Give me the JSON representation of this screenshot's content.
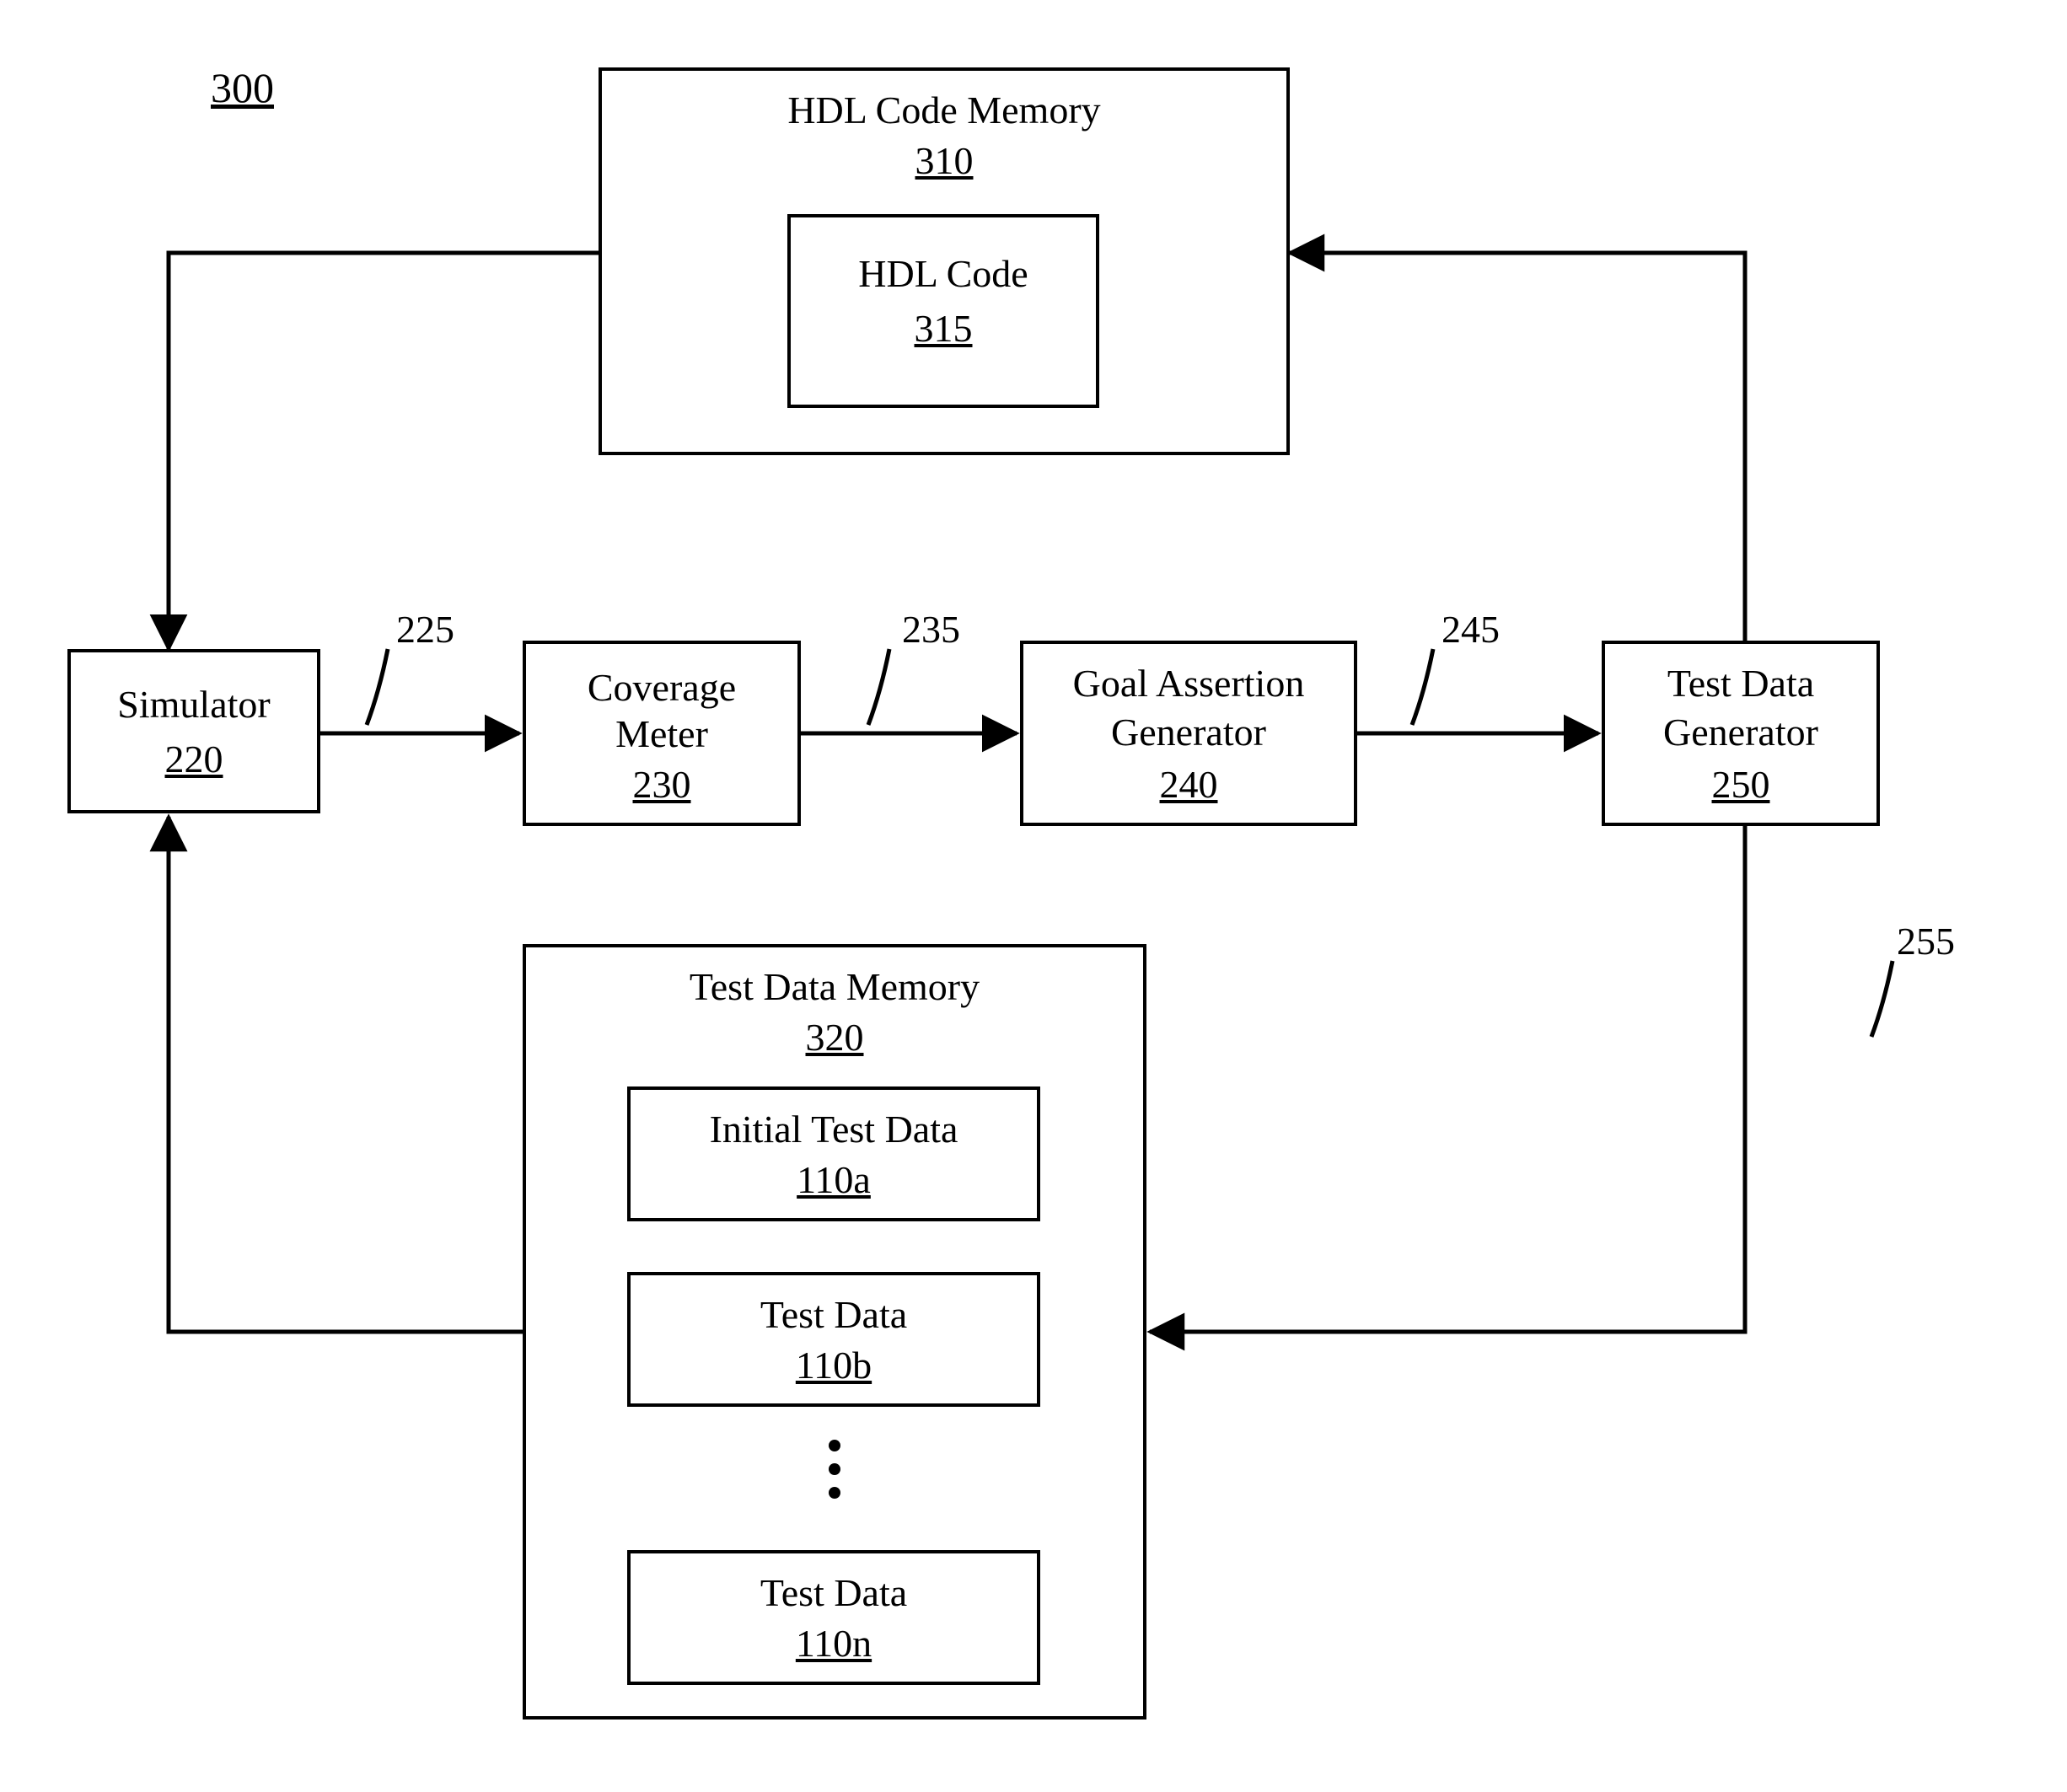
{
  "diagram_ref": "300",
  "hdl_memory": {
    "title": "HDL Code Memory",
    "ref": "310"
  },
  "hdl_code": {
    "title": "HDL Code",
    "ref": "315"
  },
  "simulator": {
    "title": "Simulator",
    "ref": "220"
  },
  "coverage": {
    "title": "Coverage Meter",
    "ref": "230"
  },
  "goal": {
    "title": "Goal Assertion Generator",
    "ref": "240"
  },
  "testgen": {
    "title": "Test Data Generator",
    "ref": "250"
  },
  "wire225": "225",
  "wire235": "235",
  "wire245": "245",
  "wire255": "255",
  "testmem": {
    "title": "Test Data Memory",
    "ref": "320"
  },
  "td_a": {
    "title": "Initial Test Data",
    "ref": "110a"
  },
  "td_b": {
    "title": "Test Data",
    "ref": "110b"
  },
  "td_n": {
    "title": "Test Data",
    "ref": "110n"
  }
}
